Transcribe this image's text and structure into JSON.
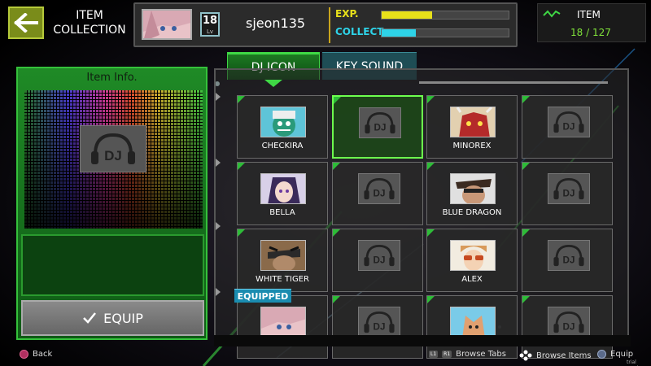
{
  "header": {
    "screen_title_line1": "ITEM",
    "screen_title_line2": "COLLECTION",
    "player": {
      "level": "18",
      "level_label": "Lv",
      "username": "sjeon135"
    },
    "stats": [
      {
        "label": "EXP.",
        "color": "#e8e11a",
        "fill": 0.4
      },
      {
        "label": "COLLECT.",
        "color": "#2ed3e8",
        "fill": 0.27
      }
    ],
    "item_panel": {
      "label": "ITEM",
      "count": "18 / 127"
    }
  },
  "left_panel": {
    "title": "Item Info.",
    "preview_icon_text": "DJ",
    "equip_label": "EQUIP"
  },
  "tabs": [
    {
      "label": "DJ ICON",
      "active": true
    },
    {
      "label": "KEY SOUND",
      "active": false
    }
  ],
  "grid": {
    "placeholder_text": "DJ",
    "items": [
      {
        "name": "CHECKIRA",
        "unlocked": true,
        "selected": false,
        "art": "checkira"
      },
      {
        "name": "",
        "unlocked": false,
        "selected": true
      },
      {
        "name": "MINOREX",
        "unlocked": true,
        "selected": false,
        "art": "minorex"
      },
      {
        "name": "",
        "unlocked": false,
        "selected": false
      },
      {
        "name": "BELLA",
        "unlocked": true,
        "selected": false,
        "art": "bella"
      },
      {
        "name": "",
        "unlocked": false,
        "selected": false
      },
      {
        "name": "BLUE DRAGON",
        "unlocked": true,
        "selected": false,
        "art": "bluedragon"
      },
      {
        "name": "",
        "unlocked": false,
        "selected": false
      },
      {
        "name": "WHITE TIGER",
        "unlocked": true,
        "selected": false,
        "art": "whitetiger"
      },
      {
        "name": "",
        "unlocked": false,
        "selected": false
      },
      {
        "name": "ALEX",
        "unlocked": true,
        "selected": false,
        "art": "alex"
      },
      {
        "name": "",
        "unlocked": false,
        "selected": false
      },
      {
        "name": "",
        "unlocked": true,
        "selected": false,
        "art": "girl"
      },
      {
        "name": "",
        "unlocked": false,
        "selected": false
      },
      {
        "name": "",
        "unlocked": true,
        "selected": false,
        "art": "fox"
      },
      {
        "name": "",
        "unlocked": false,
        "selected": false
      }
    ],
    "equipped_badge": "EQUIPPED"
  },
  "footer": {
    "back": "Back",
    "browse_tabs": "Browse Tabs",
    "l1": "L1",
    "r1": "R1",
    "browse_items": "Browse Items",
    "equip": "Equip",
    "trial": "trial version"
  },
  "colors": {
    "accent_green": "#35c23b",
    "selected_outline": "#6dff4e",
    "equipped_badge": "#1a8cb0"
  }
}
